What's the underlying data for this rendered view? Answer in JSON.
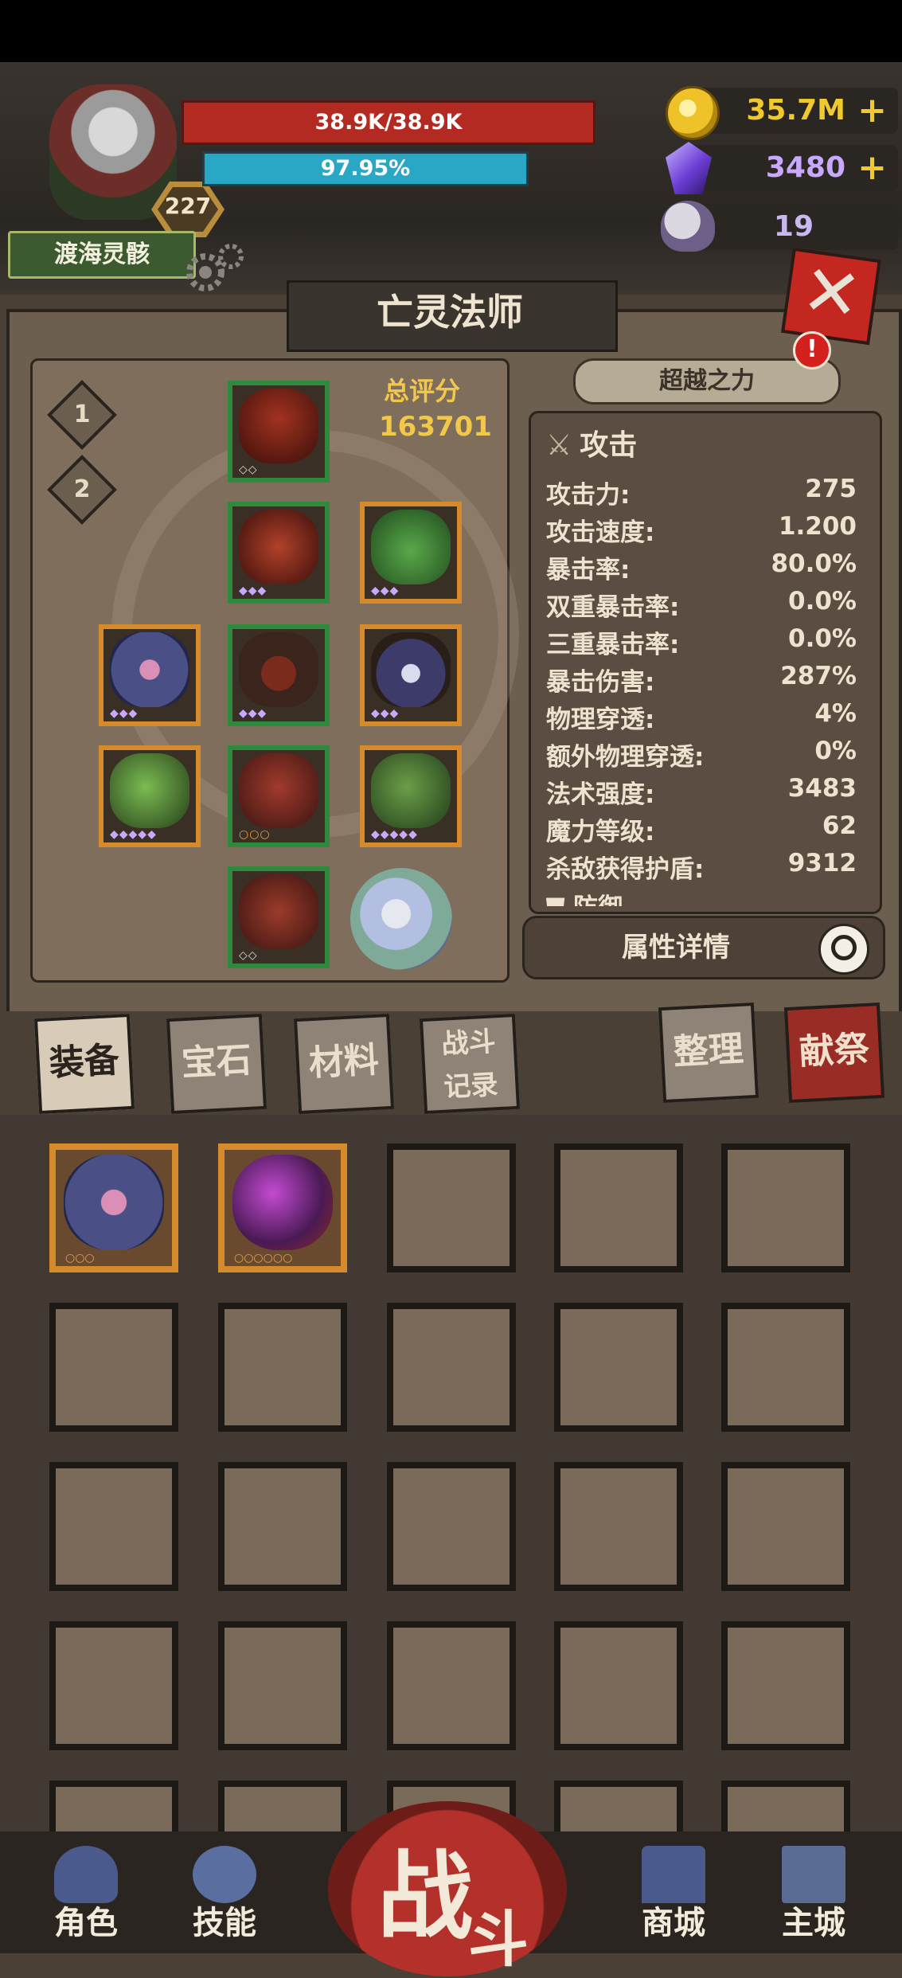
{
  "player": {
    "name": "渡海灵骸",
    "level": "227",
    "hp_text": "38.9K/38.9K",
    "mp_text": "97.95%"
  },
  "currencies": [
    {
      "value": "35.7M",
      "icon": "gold-coin-icon",
      "color": "#f2c92c",
      "has_plus": true
    },
    {
      "value": "3480",
      "icon": "purple-crystal-icon",
      "color": "#c9a8ff",
      "has_plus": true
    },
    {
      "value": "19",
      "icon": "ram-skull-icon",
      "color": "#c9b8f0",
      "has_plus": false
    }
  ],
  "plus_label": "+",
  "close_label": "✕",
  "title": "亡灵法师",
  "equipment": {
    "page_buttons": [
      "1",
      "2"
    ],
    "score_label": "总评分",
    "score_value": "163701"
  },
  "stats": {
    "transcend_label": "超越之力",
    "alert_label": "!",
    "section_title": "攻击",
    "rows": [
      {
        "k": "攻击力:",
        "v": "275"
      },
      {
        "k": "攻击速度:",
        "v": "1.200"
      },
      {
        "k": "暴击率:",
        "v": "80.0%"
      },
      {
        "k": "双重暴击率:",
        "v": "0.0%"
      },
      {
        "k": "三重暴击率:",
        "v": "0.0%"
      },
      {
        "k": "暴击伤害:",
        "v": "287%"
      },
      {
        "k": "物理穿透:",
        "v": "4%"
      },
      {
        "k": "额外物理穿透:",
        "v": "0%"
      },
      {
        "k": "法术强度:",
        "v": "3483"
      },
      {
        "k": "魔力等级:",
        "v": "62"
      },
      {
        "k": "杀敌获得护盾:",
        "v": "9312"
      }
    ],
    "next_section_partial": "防御",
    "detail_button": "属性详情"
  },
  "tabs": [
    {
      "label": "装备",
      "active": true
    },
    {
      "label": "宝石",
      "active": false
    },
    {
      "label": "材料",
      "active": false
    },
    {
      "label_line1": "战斗",
      "label_line2": "记录",
      "active": false
    },
    {
      "label": "整理",
      "active": false
    },
    {
      "label": "献祭",
      "active": false
    }
  ],
  "nav": {
    "character": "角色",
    "skills": "技能",
    "battle_a": "战",
    "battle_b": "斗",
    "shop": "商城",
    "main_city": "主城"
  },
  "colors": {
    "hp": "#b22a22",
    "mp": "#29a7c4",
    "score": "#f2c84a",
    "rarity_green": "#2f8a3e",
    "rarity_orange": "#d58a2c"
  }
}
